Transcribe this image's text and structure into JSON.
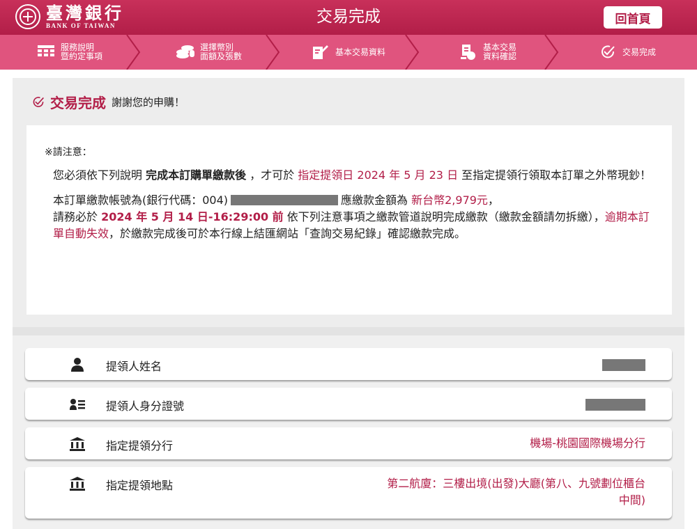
{
  "header": {
    "logo_zh": "臺灣銀行",
    "logo_en": "BANK OF TAIWAN",
    "title": "交易完成",
    "home_label": "回首頁"
  },
  "steps": [
    {
      "line1": "服務說明",
      "line2": "暨約定事項",
      "icon": "grid-icon"
    },
    {
      "line1": "選擇幣別",
      "line2": "面額及張數",
      "icon": "coins-icon"
    },
    {
      "line1": "基本交易資料",
      "line2": "",
      "icon": "edit-icon"
    },
    {
      "line1": "基本交易",
      "line2": "資料確認",
      "icon": "document-check-icon"
    },
    {
      "line1": "交易完成",
      "line2": "",
      "icon": "check-circle-icon"
    }
  ],
  "completion": {
    "title": "交易完成",
    "message": "謝謝您的申購！"
  },
  "notice": {
    "title": "※請注意：",
    "p1_a": "您必須依下列說明 ",
    "p1_b": "完成本訂購單繳款後",
    "p1_c": " ，才可於 ",
    "p1_d": "指定提領日 2024 年 5 月 23 日",
    "p1_e": " 至指定提領行領取本訂單之外幣現鈔！",
    "p2_a": "本訂單繳款帳號為(銀行代碼：004)",
    "p2_b": "應繳款金額為 ",
    "p2_c": "新台幣2,979元",
    "p2_d": "，",
    "p3_a": "請務必於 ",
    "p3_b": "2024 年 5 月 14 日-16:29:00 前",
    "p3_c": " 依下列注意事項之繳款管道說明完成繳款（繳款金額請勿拆繳），",
    "p3_d": "逾期本訂單自動失效",
    "p3_e": "，於繳款完成後可於本行線上結匯網站「查詢交易紀錄」確認繳款完成。"
  },
  "rows": [
    {
      "label": "提領人姓名",
      "value": "",
      "icon": "person-icon"
    },
    {
      "label": "提領人身分證號",
      "value": "",
      "icon": "id-card-icon"
    },
    {
      "label": "指定提領分行",
      "value": "機場-桃園國際機場分行",
      "icon": "bank-icon"
    },
    {
      "label": "指定提領地點",
      "value_line1": "第二航廈：三樓出境(出發)大廳(第八、九號劃位櫃台",
      "value_line2": "中間)",
      "icon": "bank-icon"
    }
  ],
  "colors": {
    "brand": "#b21e48",
    "steps_bg": "#e0547e",
    "content_bg": "#ededed"
  }
}
